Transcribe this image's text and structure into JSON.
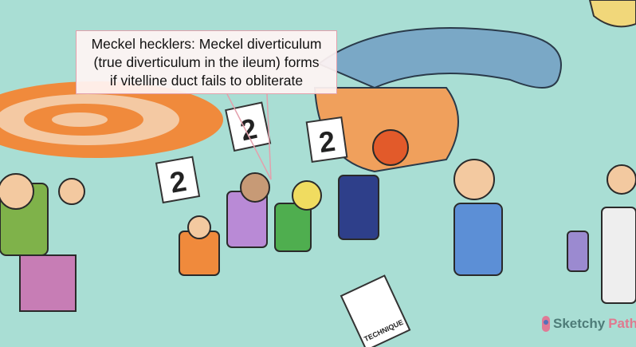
{
  "tooltip": {
    "lines": [
      "Meckel hecklers: Meckel diverticulum",
      "(true diverticulum in the ileum) forms",
      "if vitelline duct fails to obliterate"
    ]
  },
  "scorecards": [
    "2",
    "2",
    "2"
  ],
  "notebook_label": "TECHNIQUE",
  "logo": {
    "part1": "Sketchy",
    "part2": "Path"
  },
  "colors": {
    "background": "#a9ded4",
    "tooltip_border": "#e3a0ac",
    "target_orange": "#f08a3c"
  }
}
